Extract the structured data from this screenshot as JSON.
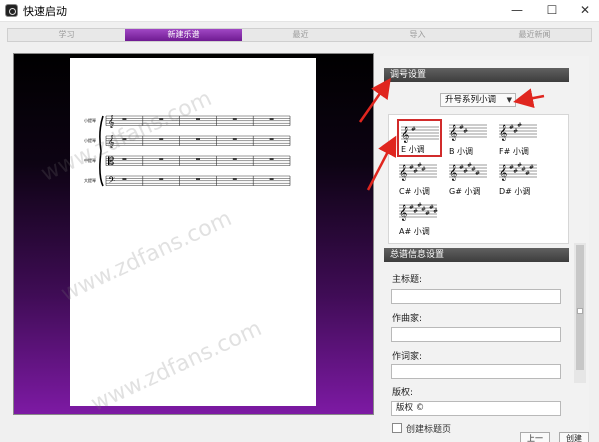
{
  "window": {
    "title": "快速启动",
    "minimize": "—",
    "maximize": "☐",
    "close": "✕"
  },
  "tabs": [
    {
      "label": "学习",
      "active": false
    },
    {
      "label": "新建乐谱",
      "active": true
    },
    {
      "label": "最近",
      "active": false
    },
    {
      "label": "导入",
      "active": false
    },
    {
      "label": "最近新闻",
      "active": false
    }
  ],
  "score": {
    "instrument_labels": [
      "小提琴",
      "小提琴",
      "中提琴",
      "大提琴"
    ],
    "clefs": [
      "treble-clef-icon",
      "treble-clef-icon",
      "alto-clef-icon",
      "bass-clef-icon"
    ],
    "measures_per_staff": 5
  },
  "watermark_text": "www.zdfans.com",
  "key_settings": {
    "header": "调号设置",
    "scale_select": "升号系列小调",
    "keys": [
      {
        "label": "E 小调",
        "sharps": 1,
        "selected": true
      },
      {
        "label": "B 小调",
        "sharps": 2,
        "selected": false
      },
      {
        "label": "F# 小调",
        "sharps": 3,
        "selected": false
      },
      {
        "label": "C# 小调",
        "sharps": 4,
        "selected": false
      },
      {
        "label": "G# 小调",
        "sharps": 5,
        "selected": false
      },
      {
        "label": "D# 小调",
        "sharps": 6,
        "selected": false
      },
      {
        "label": "A# 小调",
        "sharps": 7,
        "selected": false
      }
    ]
  },
  "score_info": {
    "header": "总谱信息设置",
    "main_title_label": "主标题:",
    "main_title_value": "",
    "composer_label": "作曲家:",
    "composer_value": "",
    "lyricist_label": "作词家:",
    "lyricist_value": "",
    "copyright_label": "版权:",
    "copyright_value": "版权 ©",
    "create_title_page_label": "创建标题页"
  },
  "footer": {
    "back_button": "上一",
    "next_button": "创建"
  },
  "colors": {
    "tab_active": "#8b2fb3",
    "canvas_bottom": "#7e1aa5",
    "annotation_red": "#e0261f",
    "selected_key_border": "#d12b2b"
  }
}
